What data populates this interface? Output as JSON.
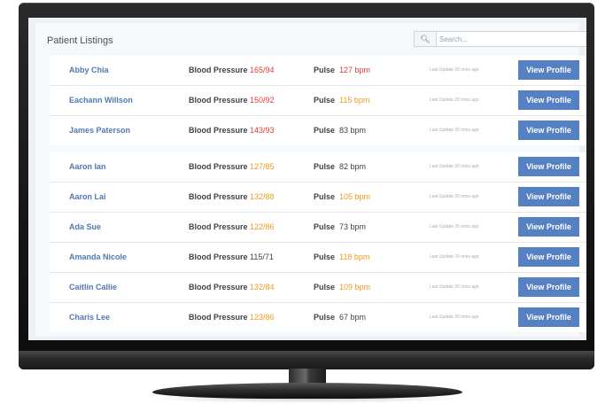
{
  "header": {
    "title": "Patient Listings",
    "search_placeholder": "Search...",
    "search_icon": "search-icon"
  },
  "labels": {
    "blood_pressure": "Blood Pressure",
    "pulse": "Pulse",
    "view_profile": "View Profile"
  },
  "colors": {
    "red": "#e33b3b",
    "orange": "#f29a20",
    "normal": "#3e434a",
    "button": "#5580c2",
    "name": "#4e79b4"
  },
  "groups": [
    {
      "patients": [
        {
          "name": "Abby Chia",
          "bp": "165/94",
          "bp_status": "red",
          "pulse": "127 bpm",
          "pulse_status": "red",
          "updated": "Last Update 20 mins ago"
        },
        {
          "name": "Eachann Willson",
          "bp": "150/92",
          "bp_status": "red",
          "pulse": "115 bpm",
          "pulse_status": "orange",
          "updated": "Last Update 20 mins ago"
        },
        {
          "name": "James Paterson",
          "bp": "143/93",
          "bp_status": "red",
          "pulse": "83 bpm",
          "pulse_status": "normal",
          "updated": "Last Update 20 mins ago"
        }
      ]
    },
    {
      "patients": [
        {
          "name": "Aaron Ian",
          "bp": "127/85",
          "bp_status": "orange",
          "pulse": "82 bpm",
          "pulse_status": "normal",
          "updated": "Last Update 20 mins ago"
        },
        {
          "name": "Aaron Lai",
          "bp": "132/88",
          "bp_status": "orange",
          "pulse": "105 bpm",
          "pulse_status": "orange",
          "updated": "Last Update 20 mins ago"
        },
        {
          "name": "Ada Sue",
          "bp": "122/86",
          "bp_status": "orange",
          "pulse": "73 bpm",
          "pulse_status": "normal",
          "updated": "Last Update 20 mins ago"
        },
        {
          "name": "Amanda Nicole",
          "bp": "115/71",
          "bp_status": "normal",
          "pulse": "118 bpm",
          "pulse_status": "orange",
          "updated": "Last Update 20 mins ago"
        },
        {
          "name": "Caitlin Callie",
          "bp": "132/84",
          "bp_status": "orange",
          "pulse": "109 bpm",
          "pulse_status": "orange",
          "updated": "Last Update 20 mins ago"
        },
        {
          "name": "Charis Lee",
          "bp": "123/86",
          "bp_status": "orange",
          "pulse": "67 bpm",
          "pulse_status": "normal",
          "updated": "Last Update 20 mins ago"
        }
      ]
    }
  ]
}
